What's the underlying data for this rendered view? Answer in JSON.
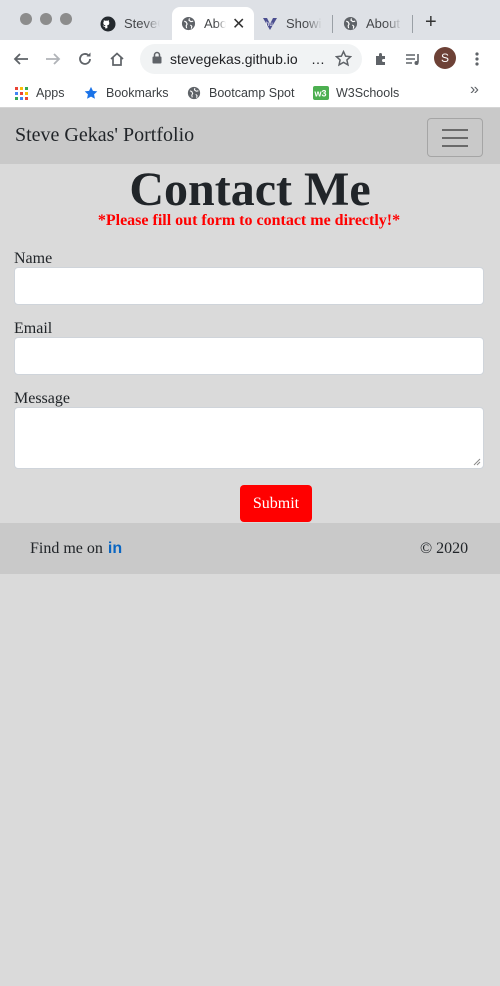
{
  "browser": {
    "tabs": [
      {
        "title": "SteveGekas",
        "icon": "github-icon"
      },
      {
        "title": "About",
        "icon": "globe-icon",
        "active": true
      },
      {
        "title": "Showing",
        "icon": "hu-icon"
      },
      {
        "title": "About Me",
        "icon": "globe-icon"
      }
    ],
    "url": "stevegekas.github.io",
    "profile_initial": "S",
    "bookmarks": [
      {
        "label": "Apps",
        "icon": "apps-grid-icon"
      },
      {
        "label": "Bookmarks",
        "icon": "star-icon"
      },
      {
        "label": "Bootcamp Spot",
        "icon": "globe-icon"
      },
      {
        "label": "W3Schools",
        "icon": "w3-icon"
      }
    ]
  },
  "page": {
    "brand": "Steve Gekas' Portfolio",
    "heading": "Contact Me",
    "notice": "*Please fill out form to contact me directly!*",
    "form": {
      "name_label": "Name",
      "name_value": "",
      "email_label": "Email",
      "email_value": "",
      "message_label": "Message",
      "message_value": "",
      "submit_label": "Submit"
    },
    "footer": {
      "find_text": "Find me on",
      "linkedin": "in",
      "copyright": "© 2020"
    }
  },
  "colors": {
    "accent": "#ff0000",
    "navbar": "#c9c9c9",
    "background": "#dadada",
    "linkedin": "#0a66c2"
  }
}
